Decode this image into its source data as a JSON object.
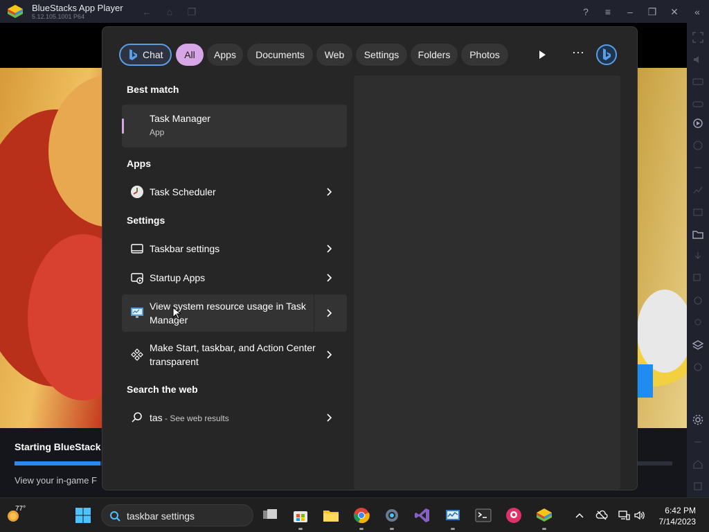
{
  "window": {
    "title": "BlueStacks App Player",
    "version": "5.12.105.1001 P64"
  },
  "game": {
    "starting_text": "Starting BlueStack",
    "ingame_text": "View your in-game F",
    "progress_percent": 13
  },
  "search": {
    "filters": [
      {
        "label": "Chat",
        "state": "chat"
      },
      {
        "label": "All",
        "state": "active"
      },
      {
        "label": "Apps",
        "state": "normal"
      },
      {
        "label": "Documents",
        "state": "normal"
      },
      {
        "label": "Web",
        "state": "normal"
      },
      {
        "label": "Settings",
        "state": "normal"
      },
      {
        "label": "Folders",
        "state": "normal"
      },
      {
        "label": "Photos",
        "state": "normal"
      }
    ],
    "more_label": "···",
    "best_match_heading": "Best match",
    "best_match": {
      "title": "Task Manager",
      "subtitle": "App"
    },
    "apps_heading": "Apps",
    "apps": [
      {
        "title": "Task Scheduler",
        "icon": "task-scheduler-icon"
      }
    ],
    "settings_heading": "Settings",
    "settings": [
      {
        "title": "Taskbar settings",
        "icon": "taskbar-icon"
      },
      {
        "title": "Startup Apps",
        "icon": "startup-apps-icon"
      },
      {
        "title": "View system resource usage in Task Manager",
        "icon": "monitor-icon"
      },
      {
        "title": "Make Start, taskbar, and Action Center transparent",
        "icon": "transparency-icon"
      }
    ],
    "web_heading": "Search the web",
    "web": {
      "query": "tas",
      "suffix": " - See web results"
    }
  },
  "taskbar": {
    "weather_temp": "77°",
    "search_text": "taskbar settings",
    "clock_time": "6:42 PM",
    "clock_date": "7/14/2023"
  },
  "colors": {
    "accent": "#d7a6e6",
    "chat_border": "#5b9ee6",
    "bluestacks_progress": "#2a8af0"
  }
}
